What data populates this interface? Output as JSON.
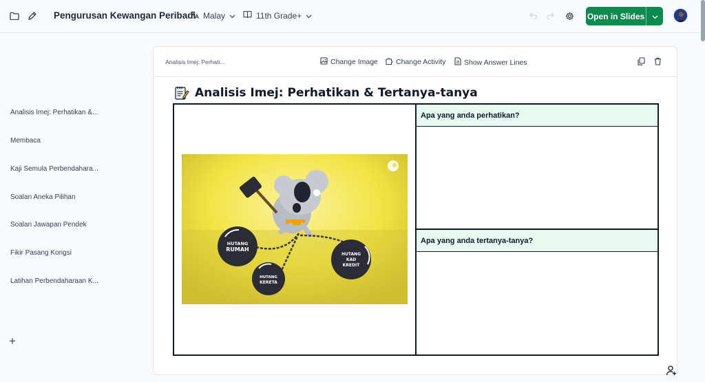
{
  "header": {
    "title": "Pengurusan Kewangan Peribadi",
    "language": "Malay",
    "grade": "11th Grade+",
    "open_slides": "Open in Slides"
  },
  "sidebar": {
    "items": [
      {
        "label": "Analisis Imej: Perhatikan &..."
      },
      {
        "label": "Membaca"
      },
      {
        "label": "Kaji Semula Perbendahara..."
      },
      {
        "label": "Soalan Aneka Pilihan"
      },
      {
        "label": "Soalan Jawapan Pendek"
      },
      {
        "label": "Fikir Pasang Kongsi"
      },
      {
        "label": "Latihan Perbendaharaan K..."
      }
    ],
    "add": "+"
  },
  "card": {
    "breadcrumb": "Analisis Imej: Perhati...",
    "tools": {
      "change_image": "Change Image",
      "change_activity": "Change Activity",
      "show_answer_lines": "Show Answer Lines"
    },
    "activity_title": "Analisis Imej: Perhatikan & Tertanya-tanya",
    "questions": [
      {
        "label": "Apa yang anda perhatikan?"
      },
      {
        "label": "Apa yang anda tertanya-tanya?"
      }
    ]
  },
  "illustration": {
    "ball_rumah_line1": "HUTANG",
    "ball_rumah_line2": "RUMAH",
    "ball_kereta_line1": "HUTANG",
    "ball_kereta_line2": "KERETA",
    "ball_kad_line1": "HUTANG",
    "ball_kad_line2": "KAD",
    "ball_kad_line3": "KREDIT"
  },
  "colors": {
    "accent_green": "#0f8a4f",
    "question_bg": "#e8faf2",
    "illustration_bg": "#f3e445"
  },
  "icons": [
    "folder-icon",
    "edit-icon",
    "translate-icon",
    "chevron-down-icon",
    "book-icon",
    "undo-icon",
    "redo-icon",
    "gear-icon",
    "image-icon",
    "puzzle-icon",
    "document-icon",
    "copy-icon",
    "trash-icon",
    "notepad-icon",
    "add-user-icon"
  ]
}
